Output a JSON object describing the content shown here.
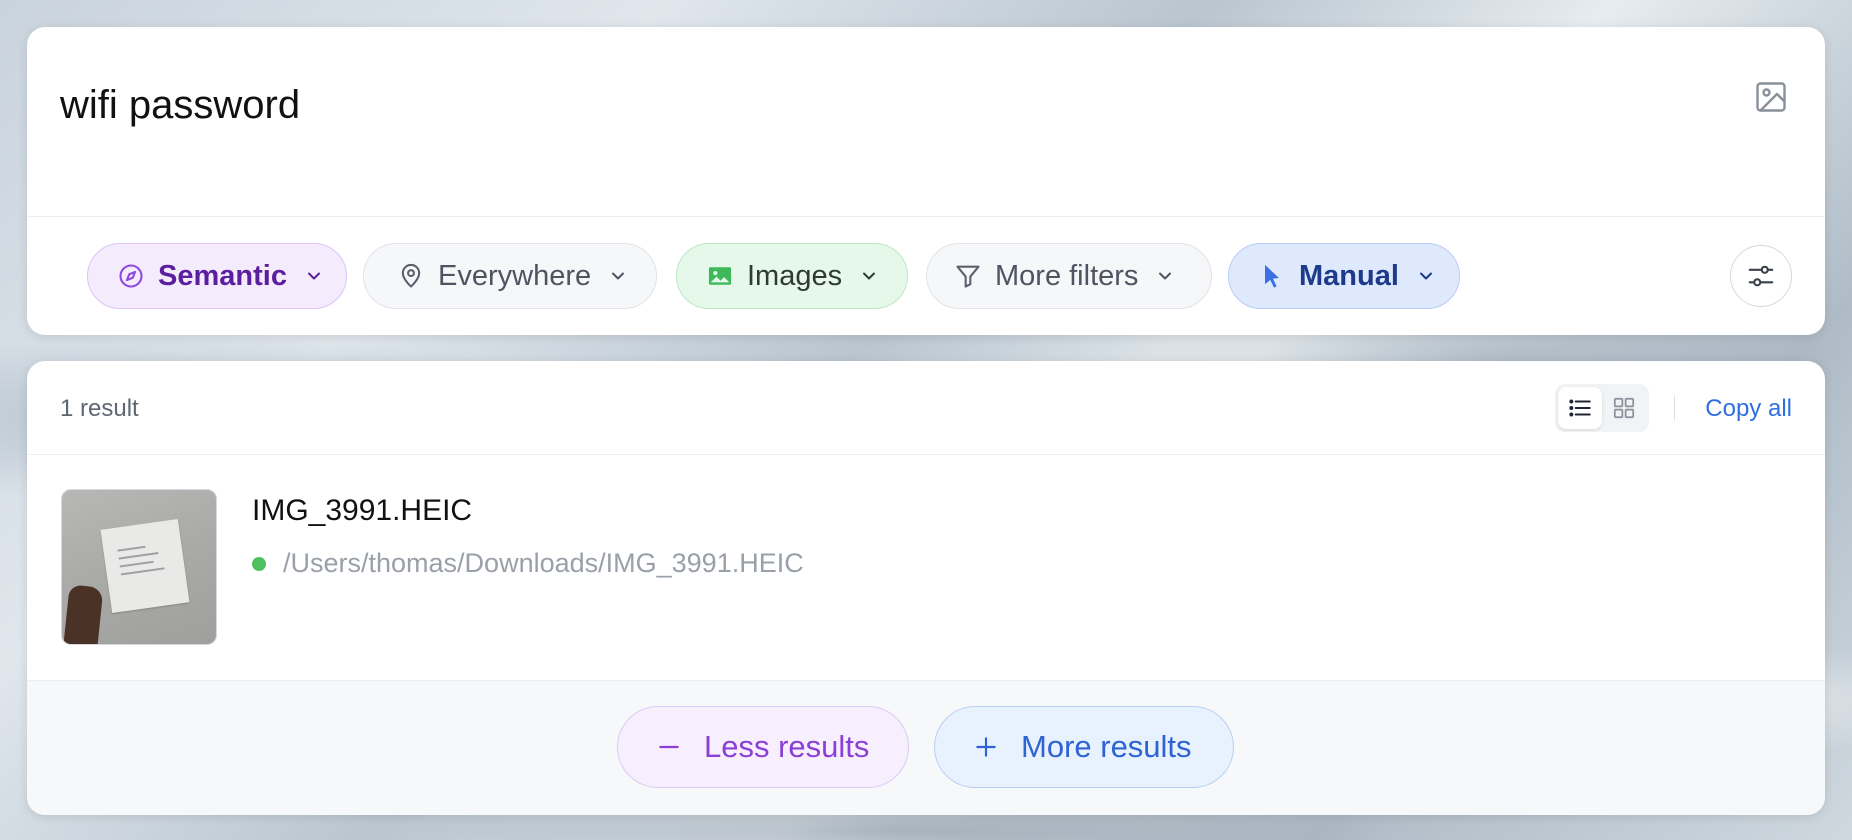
{
  "search": {
    "query": "wifi password",
    "image_search_icon": "image-icon"
  },
  "filters": {
    "mode": {
      "label": "Semantic",
      "icon": "compass-icon",
      "color": "#5b1e9e"
    },
    "location": {
      "label": "Everywhere",
      "icon": "map-pin-icon"
    },
    "type": {
      "label": "Images",
      "icon": "image-icon",
      "color": "#3db95a"
    },
    "more": {
      "label": "More filters",
      "icon": "filter-icon"
    },
    "selection": {
      "label": "Manual",
      "icon": "cursor-icon",
      "color": "#3b6fe3"
    },
    "settings_icon": "sliders-icon"
  },
  "results": {
    "count_label": "1 result",
    "copy_all_label": "Copy all",
    "view_modes": [
      "list",
      "grid"
    ],
    "active_view": "list",
    "items": [
      {
        "name": "IMG_3991.HEIC",
        "path": "/Users/thomas/Downloads/IMG_3991.HEIC",
        "status_color": "#4fc060"
      }
    ],
    "less_label": "Less results",
    "more_label": "More results"
  }
}
